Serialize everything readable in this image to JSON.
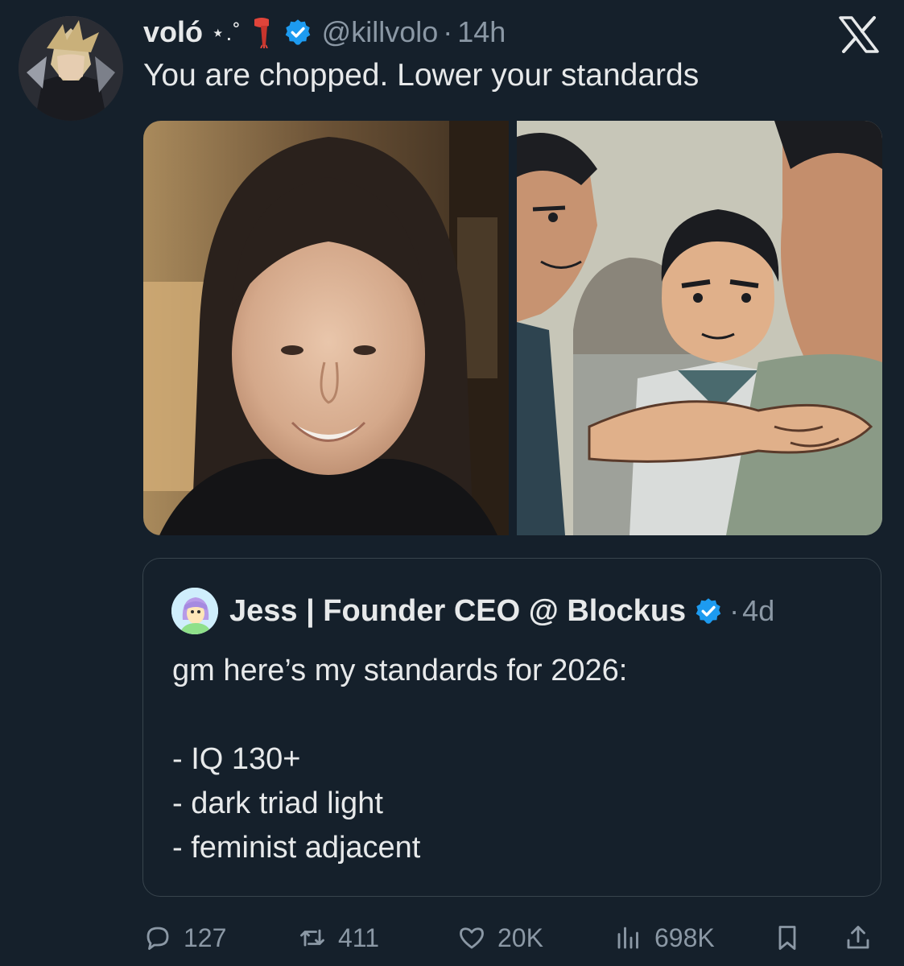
{
  "tweet": {
    "display_name": "voló",
    "name_suffix": "⋆.˚",
    "handle": "@killvolo",
    "separator": "·",
    "time": "14h",
    "text": "You are chopped. Lower your standards",
    "verified": true,
    "scarf_icon": "scarf-icon",
    "logo": "x-logo-icon"
  },
  "quoted_tweet": {
    "name": "Jess | Founder CEO @ Blockus",
    "separator": "·",
    "time": "4d",
    "verified": true,
    "lines": [
      "gm here’s my standards for 2026:",
      "",
      "- IQ 130+",
      "- dark triad light",
      "- feminist adjacent"
    ]
  },
  "actions": {
    "replies": "127",
    "reposts": "411",
    "likes": "20K",
    "views": "698K"
  },
  "colors": {
    "background": "#15202b",
    "text": "#e7e9ea",
    "secondary": "#8b98a5",
    "verified": "#1d9bf0",
    "border": "#38444d"
  }
}
